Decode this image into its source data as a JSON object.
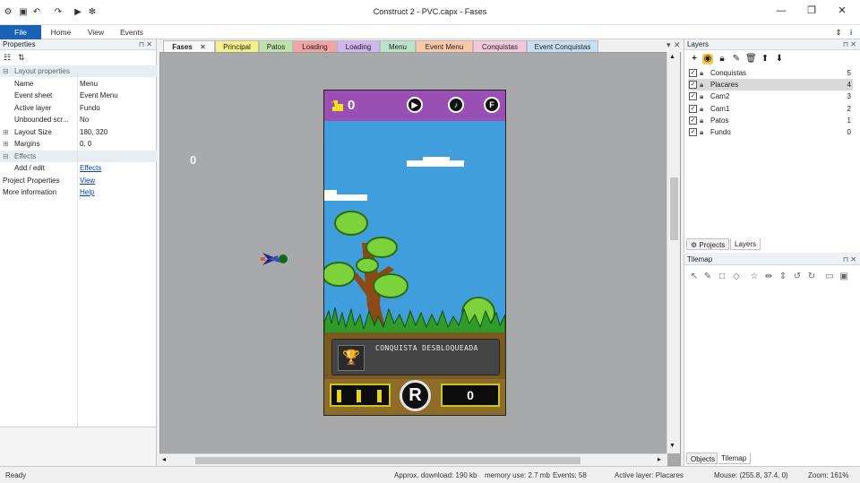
{
  "window": {
    "title": "Construct 2 - PVC.capx - Fases"
  },
  "ribbon": {
    "tabs": [
      "File",
      "Home",
      "View",
      "Events"
    ]
  },
  "properties": {
    "title": "Properties",
    "sections": {
      "layout": "Layout properties",
      "effects": "Effects"
    },
    "rows": [
      {
        "key": "Name",
        "value": "Menu"
      },
      {
        "key": "Event sheet",
        "value": "Event Menu"
      },
      {
        "key": "Active layer",
        "value": "Fundo"
      },
      {
        "key": "Unbounded scr...",
        "value": "No"
      },
      {
        "key": "Layout Size",
        "value": "180, 320"
      },
      {
        "key": "Margins",
        "value": "0, 0"
      }
    ],
    "effects_row": {
      "key": "Add / edit",
      "value": "Effects"
    },
    "project_row": {
      "key": "Project Properties",
      "value": "View"
    },
    "more_row": {
      "key": "More information",
      "value": "Help"
    }
  },
  "doc_tabs": [
    {
      "label": "Fases",
      "color": "#f7f7f7"
    },
    {
      "label": "Principal",
      "color": "#f4ef8a"
    },
    {
      "label": "Patos",
      "color": "#bfe3a8"
    },
    {
      "label": "Loading",
      "color": "#f3a3a3"
    },
    {
      "label": "Loading",
      "color": "#cfb6ee"
    },
    {
      "label": "Menu",
      "color": "#b8e3c8"
    },
    {
      "label": "Event Menu",
      "color": "#f8c9a8"
    },
    {
      "label": "Conquistas",
      "color": "#f5c7dc"
    },
    {
      "label": "Event Conquistas",
      "color": "#c5dff3"
    }
  ],
  "game": {
    "duck_score": "0",
    "hud_buttons": [
      "play",
      "music",
      "F"
    ],
    "f_label": "F",
    "banner_text": "CONQUISTA DESBLOQUEADA",
    "score": "0",
    "r_label": "R"
  },
  "editor": {
    "offcanvas_score": "0"
  },
  "layers": {
    "title": "Layers",
    "items": [
      {
        "name": "Conquistas",
        "number": "5"
      },
      {
        "name": "Placares",
        "number": "4"
      },
      {
        "name": "Cam2",
        "number": "3"
      },
      {
        "name": "Cam1",
        "number": "2"
      },
      {
        "name": "Patos",
        "number": "1"
      },
      {
        "name": "Fundo",
        "number": "0"
      }
    ],
    "bottom_tabs": [
      "Projects",
      "Layers"
    ]
  },
  "tilemap": {
    "title": "Tilemap",
    "bottom_tabs": [
      "Objects",
      "Tilemap"
    ]
  },
  "status": {
    "ready": "Ready",
    "download": "Approx. download: 190 kb",
    "memory": "memory use: 2.7 mb",
    "events": "Events: 58",
    "active_layer": "Active layer: Placares",
    "mouse": "Mouse: (255.8, 37.4, 0)",
    "zoom": "Zoom: 161%"
  },
  "colors": {
    "accent": "#1a62b8",
    "hud_purple": "#9a4fb5",
    "sky": "#3f9edb",
    "grass": "#2e9c26"
  }
}
